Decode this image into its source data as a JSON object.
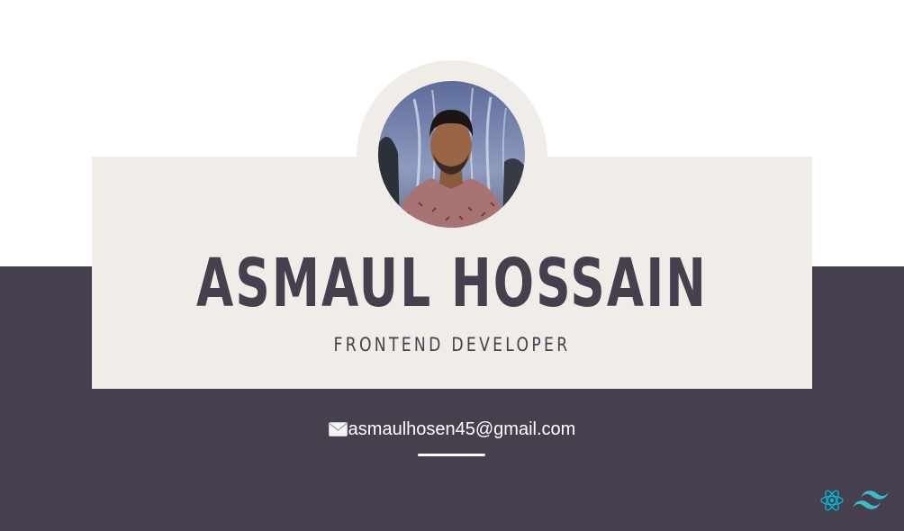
{
  "profile": {
    "name": "ASMAUL HOSSAIN",
    "role": "FRONTEND DEVELOPER",
    "email": "asmaulhosen45@gmail.com"
  },
  "icons": {
    "email": "envelope-icon",
    "tech": [
      "react-icon",
      "tailwind-icon"
    ]
  },
  "colors": {
    "dark": "#463f4d",
    "card": "#f0ede9",
    "accent": "#06b6d4",
    "background": "#ffffff"
  }
}
